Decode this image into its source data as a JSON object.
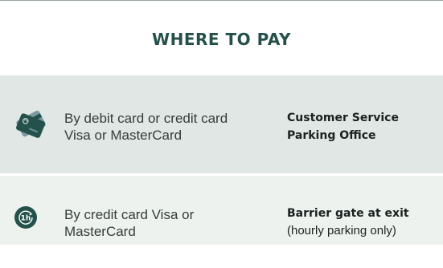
{
  "heading": "WHERE TO PAY",
  "rows": [
    {
      "icon": "credit-card-icon",
      "method": "By debit card or credit card\nVisa or MasterCard",
      "location": "Customer Service\nParking Office",
      "note": ""
    },
    {
      "icon": "one-hour-icon",
      "icon_text": "1h",
      "method": "By credit card Visa or\nMasterCard",
      "location": "Barrier gate at exit",
      "note": "(hourly parking only)"
    }
  ],
  "colors": {
    "heading": "#25504a",
    "row_1_bg": "#e1e7e4",
    "row_2_bg": "#eef2ef",
    "icon_dark": "#24524b",
    "icon_mid": "#6f8d97"
  }
}
